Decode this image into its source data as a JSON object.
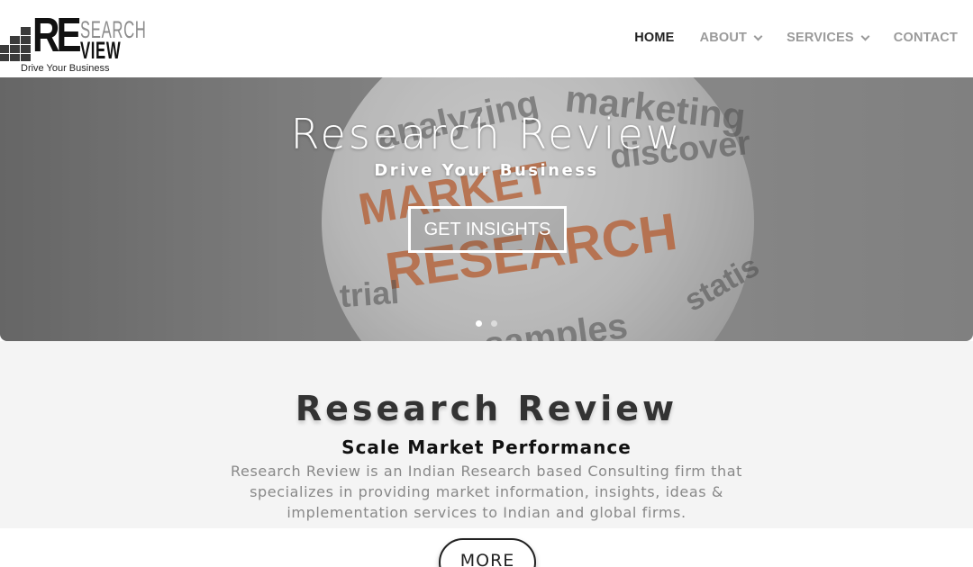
{
  "logo": {
    "re": "RE",
    "search": "SEARCH",
    "view": "VIEW",
    "tagline": "Drive Your Business"
  },
  "nav": {
    "items": [
      {
        "label": "HOME",
        "active": true,
        "has_dropdown": false
      },
      {
        "label": "ABOUT",
        "active": false,
        "has_dropdown": true
      },
      {
        "label": "SERVICES",
        "active": false,
        "has_dropdown": true
      },
      {
        "label": "CONTACT",
        "active": false,
        "has_dropdown": false
      }
    ]
  },
  "hero": {
    "title": "Research Review",
    "subtitle": "Drive Your Business",
    "button_label": "GET INSIGHTS",
    "slides_count": 2,
    "active_slide": 1
  },
  "about": {
    "title": "Research Review",
    "subtitle": "Scale Market Performance",
    "description": "Research Review is an Indian Research based Consulting firm that specializes in providing market information, insights, ideas & implementation services to Indian and global firms.",
    "more_label": "MORE"
  },
  "colors": {
    "nav_active": "#222222",
    "nav_inactive": "#9a9a9a",
    "section_bg": "#f4f4f4",
    "accent_orange": "#d9652b"
  }
}
